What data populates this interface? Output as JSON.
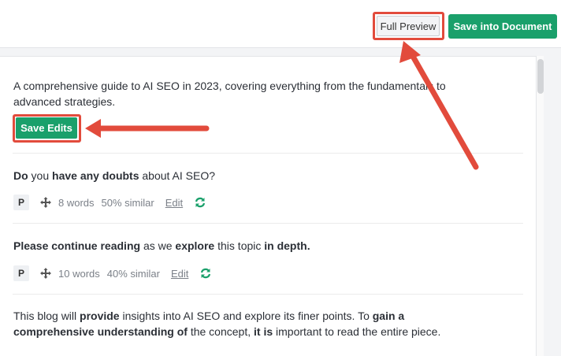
{
  "header": {
    "full_preview_label": "Full Preview",
    "save_document_label": "Save into Document"
  },
  "intro": {
    "text": "A comprehensive guide to AI SEO in 2023, covering everything from the fundamentals to advanced strategies.",
    "save_edits_label": "Save Edits"
  },
  "sentences": [
    {
      "parts": [
        [
          "Do",
          true
        ],
        [
          " you ",
          false
        ],
        [
          "have any doubts",
          true
        ],
        [
          " about AI SEO?",
          false
        ]
      ],
      "badge": "P",
      "words": "8 words",
      "similar": "50% similar",
      "edit_label": "Edit"
    },
    {
      "parts": [
        [
          "Please continue reading",
          true
        ],
        [
          " as we ",
          false
        ],
        [
          "explore",
          true
        ],
        [
          " this topic ",
          false
        ],
        [
          "in depth.",
          true
        ]
      ],
      "badge": "P",
      "words": "10 words",
      "similar": "40% similar",
      "edit_label": "Edit"
    },
    {
      "parts": [
        [
          "This blog will ",
          false
        ],
        [
          "provide",
          true
        ],
        [
          " insights into AI SEO and explore its finer points. To ",
          false
        ],
        [
          "gain a comprehensive understanding of",
          true
        ],
        [
          " the concept, ",
          false
        ],
        [
          "it is",
          true
        ],
        [
          " important to read the entire piece.",
          false
        ]
      ]
    }
  ],
  "colors": {
    "accent_green": "#1aa06b",
    "annotation_red": "#e24b3c",
    "refresh_green": "#1aa06b"
  }
}
